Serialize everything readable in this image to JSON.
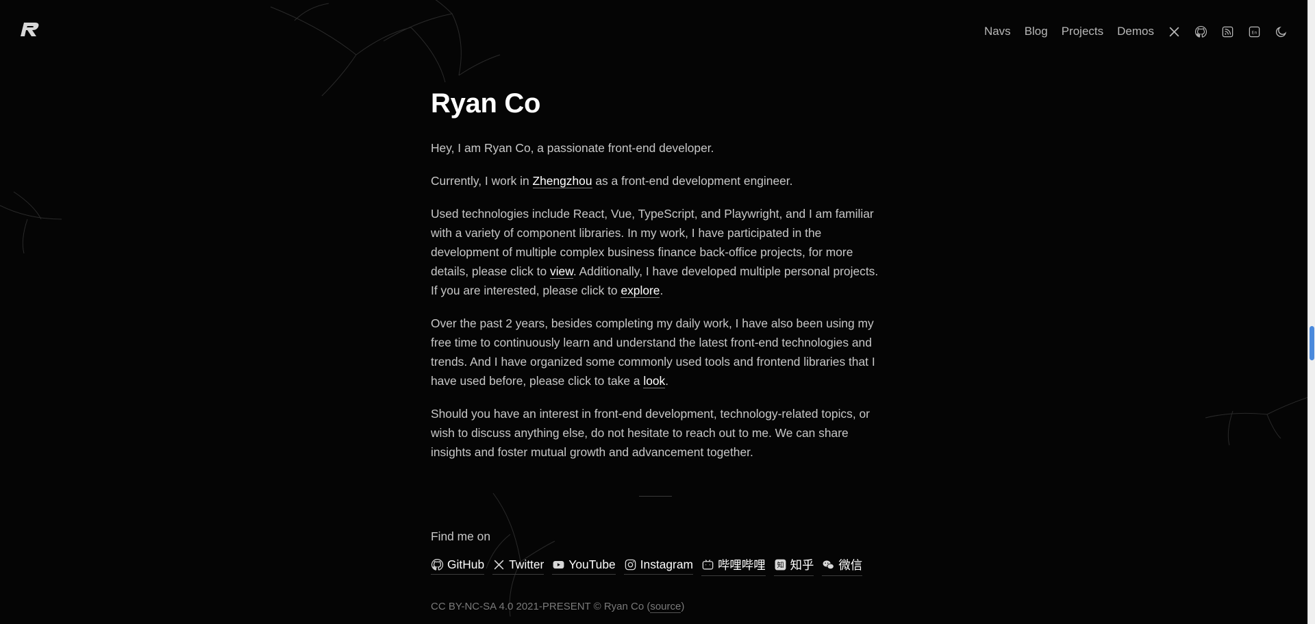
{
  "header": {
    "nav_links": [
      "Navs",
      "Blog",
      "Projects",
      "Demos"
    ],
    "icons": [
      "x-twitter-icon",
      "github-icon",
      "rss-icon",
      "language-icon",
      "moon-icon"
    ]
  },
  "main": {
    "title": "Ryan Co",
    "p1": "Hey, I am Ryan Co, a passionate front-end developer.",
    "p2": {
      "before": "Currently, I work in ",
      "link": "Zhengzhou",
      "after": " as a front-end development engineer."
    },
    "p3": {
      "part1": "Used technologies include React, Vue, TypeScript, and Playwright, and I am familiar with a variety of component libraries. In my work, I have participated in the development of multiple complex business finance back-office projects, for more details, please click to ",
      "link1": "view",
      "part2": ". Additionally, I have developed multiple personal projects. If you are interested, please click to ",
      "link2": "explore",
      "part3": "."
    },
    "p4": {
      "part1": "Over the past 2 years, besides completing my daily work, I have also been using my free time to continuously learn and understand the latest front-end technologies and trends. And I have organized some commonly used tools and frontend libraries that I have used before, please click to take a ",
      "link": "look",
      "part2": "."
    },
    "p5": "Should you have an interest in front-end development, technology-related topics, or wish to discuss anything else, do not hesitate to reach out to me. We can share insights and foster mutual growth and advancement together.",
    "find_label": "Find me on",
    "socials": [
      {
        "label": "GitHub",
        "icon": "github-icon"
      },
      {
        "label": "Twitter",
        "icon": "x-twitter-icon"
      },
      {
        "label": "YouTube",
        "icon": "youtube-icon"
      },
      {
        "label": "Instagram",
        "icon": "instagram-icon"
      },
      {
        "label": "哔哩哔哩",
        "icon": "bilibili-icon"
      },
      {
        "label": "知乎",
        "icon": "zhihu-icon"
      },
      {
        "label": "微信",
        "icon": "wechat-icon"
      }
    ],
    "footer": {
      "text": "CC BY-NC-SA 4.0 2021-PRESENT © Ryan Co (",
      "source": "source",
      "close": ")"
    }
  },
  "colors": {
    "background": "#050505",
    "text": "#c8c8c8",
    "heading": "#ffffff",
    "scroll_thumb": "#4a89dc"
  }
}
